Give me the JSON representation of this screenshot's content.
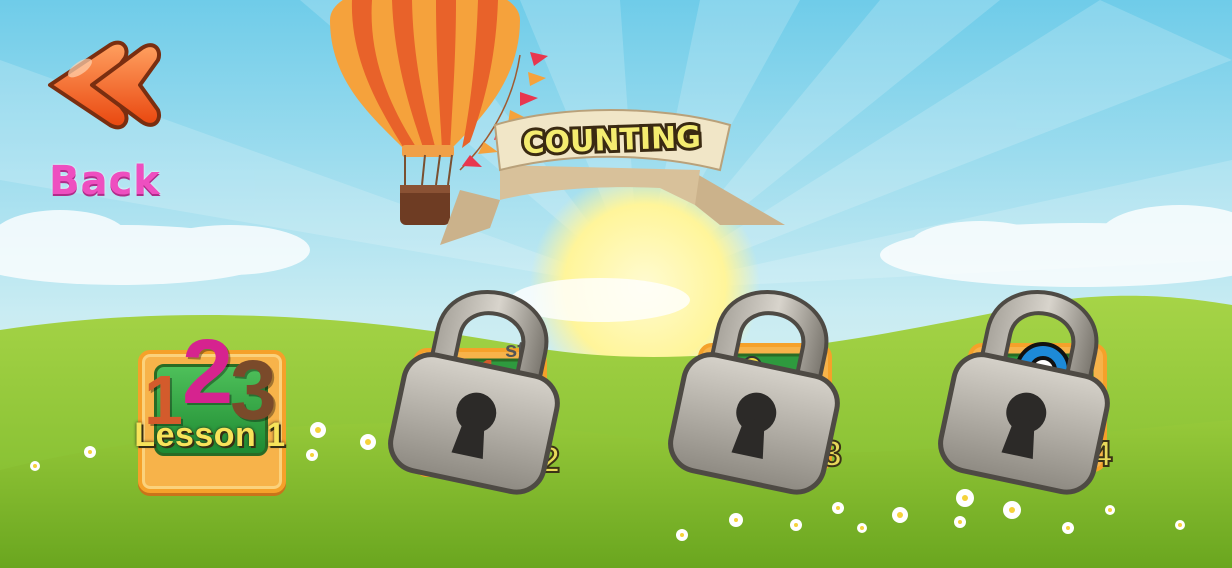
{
  "title": "COUNTING",
  "back": {
    "label": "Back"
  },
  "lessons": [
    {
      "label": "Lesson 1",
      "locked": false,
      "digits": [
        "1",
        "2",
        "3"
      ]
    },
    {
      "label": "2",
      "locked": true
    },
    {
      "label": "3",
      "locked": true
    },
    {
      "label": "4",
      "locked": true
    }
  ],
  "colors": {
    "sky_top": "#7fd3ee",
    "grass": "#7fbf2a",
    "back_arrow": "#f05a1a",
    "back_text": "#ee4fc0",
    "lesson_frame": "#f5a12a",
    "lesson_inner": "#2e9a3e"
  }
}
